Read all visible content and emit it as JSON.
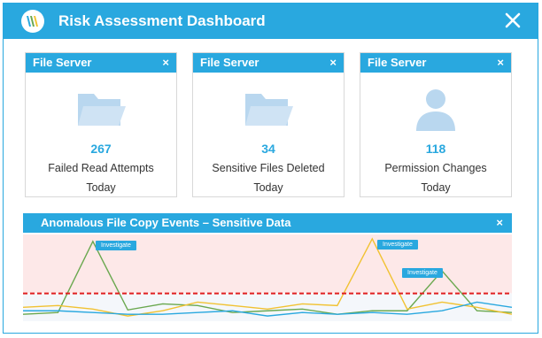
{
  "app": {
    "title": "Risk Assessment Dashboard",
    "accent": "#29a8df"
  },
  "cards": [
    {
      "header": "File Server",
      "icon": "folder-icon",
      "value": "267",
      "description": "Failed Read Attempts",
      "period": "Today"
    },
    {
      "header": "File Server",
      "icon": "folder-icon",
      "value": "34",
      "description": "Sensitive Files Deleted",
      "period": "Today"
    },
    {
      "header": "File Server",
      "icon": "user-icon",
      "value": "118",
      "description": "Permission Changes",
      "period": "Today"
    }
  ],
  "close_glyph": "×",
  "chart_panel": {
    "title": "Anomalous File Copy Events  – Sensitive Data",
    "investigate_label": "Investigate"
  },
  "chart_data": {
    "type": "line",
    "x": [
      0,
      1,
      2,
      3,
      4,
      5,
      6,
      7,
      8,
      9,
      10,
      11,
      12,
      13,
      14
    ],
    "ylim": [
      0,
      100
    ],
    "threshold": 32,
    "threshold_color": "#e02020",
    "alert_band_color": "#fde8e8",
    "series": [
      {
        "color": "#6aa84f",
        "values": [
          8,
          10,
          92,
          13,
          20,
          18,
          10,
          12,
          14,
          8,
          12,
          12,
          58,
          12,
          10
        ]
      },
      {
        "color": "#f1c232",
        "values": [
          16,
          18,
          14,
          6,
          12,
          22,
          18,
          14,
          20,
          18,
          95,
          14,
          22,
          16,
          8
        ]
      },
      {
        "color": "#29a8df",
        "values": [
          12,
          12,
          10,
          8,
          8,
          10,
          12,
          6,
          10,
          8,
          10,
          8,
          12,
          22,
          16
        ]
      }
    ]
  }
}
